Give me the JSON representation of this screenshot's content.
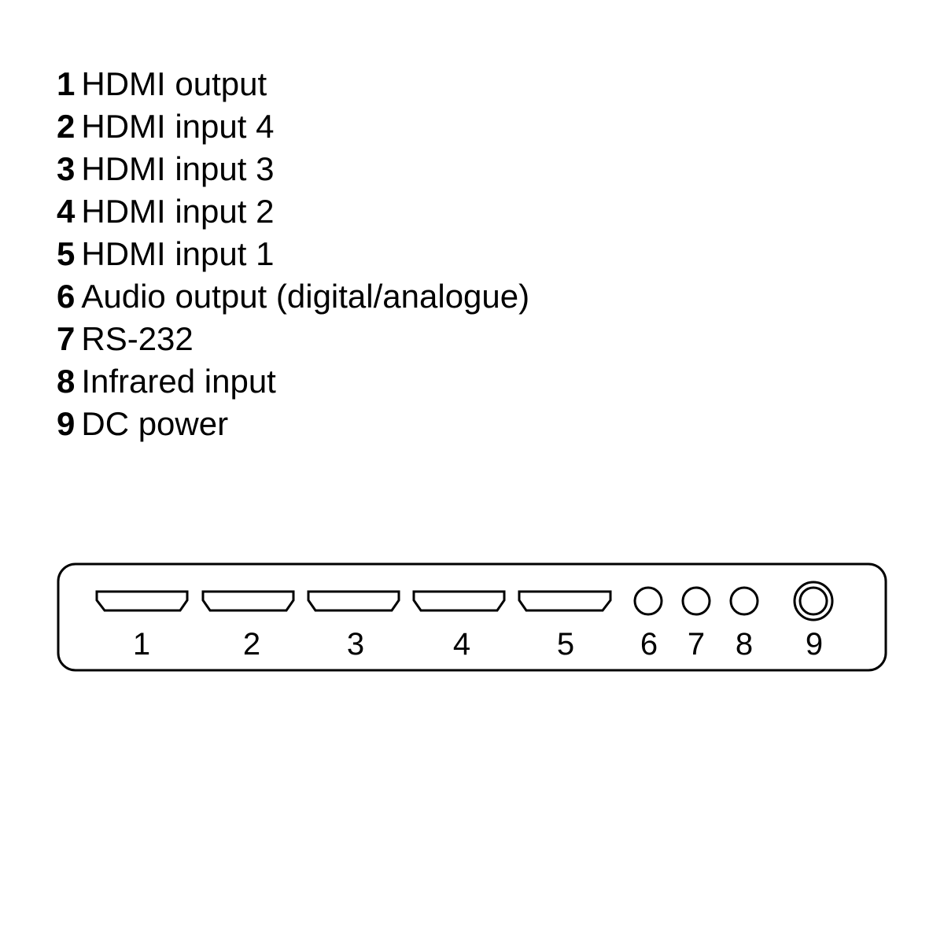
{
  "legend": {
    "items": [
      {
        "num": "1",
        "label": "HDMI output"
      },
      {
        "num": "2",
        "label": "HDMI input 4"
      },
      {
        "num": "3",
        "label": "HDMI input 3"
      },
      {
        "num": "4",
        "label": "HDMI input 2"
      },
      {
        "num": "5",
        "label": "HDMI input 1"
      },
      {
        "num": "6",
        "label": "Audio output (digital/analogue)"
      },
      {
        "num": "7",
        "label": "RS-232"
      },
      {
        "num": "8",
        "label": "Infrared input"
      },
      {
        "num": "9",
        "label": "DC power"
      }
    ]
  },
  "panel": {
    "ports": [
      {
        "label": "1",
        "type": "hdmi"
      },
      {
        "label": "2",
        "type": "hdmi"
      },
      {
        "label": "3",
        "type": "hdmi"
      },
      {
        "label": "4",
        "type": "hdmi"
      },
      {
        "label": "5",
        "type": "hdmi"
      },
      {
        "label": "6",
        "type": "jack"
      },
      {
        "label": "7",
        "type": "jack"
      },
      {
        "label": "8",
        "type": "jack"
      },
      {
        "label": "9",
        "type": "dc"
      }
    ]
  },
  "colors": {
    "stroke": "#000000",
    "background": "#ffffff"
  }
}
